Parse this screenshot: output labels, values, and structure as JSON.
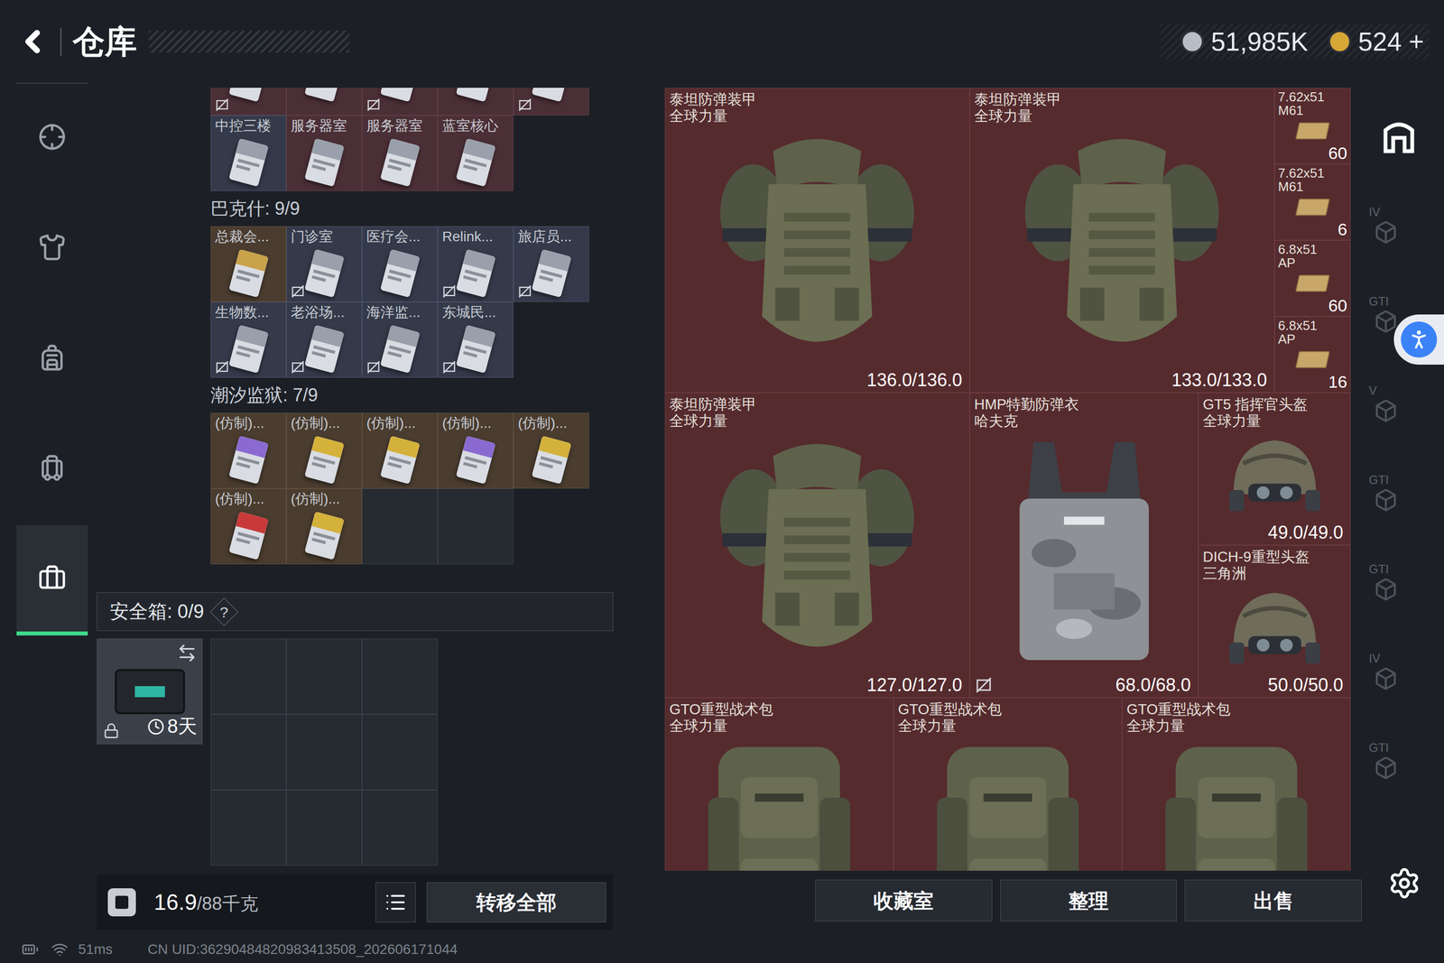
{
  "header": {
    "title": "仓库",
    "currency": [
      {
        "value": "51,985K",
        "color": "#b9bec6"
      },
      {
        "value": "524",
        "color": "#d6a637"
      }
    ],
    "add": "+"
  },
  "nav": [
    {
      "selected": false
    },
    {
      "selected": false
    },
    {
      "selected": false
    },
    {
      "selected": false
    },
    {
      "selected": true
    }
  ],
  "key_sections": [
    {
      "title": "",
      "slots": 9,
      "items": [
        {
          "label": "",
          "rarity": "red",
          "noTrade": true,
          "color": "#9aa0ab"
        },
        {
          "label": "",
          "rarity": "red",
          "noTrade": false,
          "color": "#9aa0ab"
        },
        {
          "label": "",
          "rarity": "red",
          "noTrade": true,
          "color": "#9aa0ab"
        },
        {
          "label": "",
          "rarity": "red",
          "noTrade": false,
          "color": "#9aa0ab"
        },
        {
          "label": "",
          "rarity": "red",
          "noTrade": true,
          "color": "#9aa0ab"
        },
        {
          "label": "中控三楼",
          "rarity": "blue",
          "noTrade": false,
          "color": "#9aa0ab"
        },
        {
          "label": "服务器室",
          "rarity": "red",
          "noTrade": false,
          "color": "#9aa0ab"
        },
        {
          "label": "服务器室",
          "rarity": "red",
          "noTrade": false,
          "color": "#9aa0ab"
        },
        {
          "label": "蓝室核心",
          "rarity": "red",
          "noTrade": false,
          "color": "#9aa0ab"
        }
      ]
    },
    {
      "title": "巴克什: 9/9",
      "slots": 9,
      "items": [
        {
          "label": "总裁会...",
          "rarity": "gold",
          "noTrade": false,
          "color": "#c9a24a"
        },
        {
          "label": "门诊室",
          "rarity": "blue",
          "noTrade": true,
          "color": "#9aa0ab"
        },
        {
          "label": "医疗会...",
          "rarity": "blue",
          "noTrade": false,
          "color": "#9aa0ab"
        },
        {
          "label": "Relink...",
          "rarity": "blue",
          "noTrade": true,
          "color": "#9aa0ab"
        },
        {
          "label": "旅店员...",
          "rarity": "blue",
          "noTrade": true,
          "color": "#9aa0ab"
        },
        {
          "label": "生物数...",
          "rarity": "blue",
          "noTrade": true,
          "color": "#9aa0ab"
        },
        {
          "label": "老浴场...",
          "rarity": "blue",
          "noTrade": true,
          "color": "#9aa0ab"
        },
        {
          "label": "海洋监...",
          "rarity": "blue",
          "noTrade": true,
          "color": "#9aa0ab"
        },
        {
          "label": "东城民...",
          "rarity": "blue",
          "noTrade": true,
          "color": "#9aa0ab"
        }
      ]
    },
    {
      "title": "潮汐监狱: 7/9",
      "slots": 9,
      "items": [
        {
          "label": "(仿制)...",
          "rarity": "gold",
          "noTrade": false,
          "color": "#8a6ad0"
        },
        {
          "label": "(仿制)...",
          "rarity": "gold",
          "noTrade": false,
          "color": "#d4b13a"
        },
        {
          "label": "(仿制)...",
          "rarity": "gold",
          "noTrade": false,
          "color": "#d4b13a"
        },
        {
          "label": "(仿制)...",
          "rarity": "gold",
          "noTrade": false,
          "color": "#8a6ad0"
        },
        {
          "label": "(仿制)...",
          "rarity": "gold",
          "noTrade": false,
          "color": "#d4b13a"
        },
        {
          "label": "(仿制)...",
          "rarity": "gold",
          "noTrade": false,
          "color": "#c83a3a"
        },
        {
          "label": "(仿制)...",
          "rarity": "gold",
          "noTrade": false,
          "color": "#d4b13a"
        }
      ]
    }
  ],
  "safe_box": {
    "label": "安全箱: 0/9",
    "help": "?",
    "timer": "8天",
    "locked": true,
    "slots": 9
  },
  "weight": {
    "current": "16.9",
    "max": "/88千克"
  },
  "transfer_button": "转移全部",
  "items": [
    {
      "kind": "armor",
      "name": "泰坦防弹装甲",
      "sub": "全球力量",
      "value": "136.0/136.0",
      "noTrade": false
    },
    {
      "kind": "armor",
      "name": "泰坦防弹装甲",
      "sub": "全球力量",
      "value": "133.0/133.0",
      "noTrade": false
    },
    {
      "kind": "ammo",
      "name": "7.62x51",
      "sub": "M61",
      "value": "60",
      "noTrade": false
    },
    {
      "kind": "ammo",
      "name": "7.62x51",
      "sub": "M61",
      "value": "6",
      "noTrade": false
    },
    {
      "kind": "ammo",
      "name": "6.8x51",
      "sub": "AP",
      "value": "60",
      "noTrade": false
    },
    {
      "kind": "ammo",
      "name": "6.8x51",
      "sub": "AP",
      "value": "16",
      "noTrade": false
    },
    {
      "kind": "armor",
      "name": "泰坦防弹装甲",
      "sub": "全球力量",
      "value": "127.0/127.0",
      "noTrade": false
    },
    {
      "kind": "vest",
      "name": "HMP特勤防弹衣",
      "sub": "哈夫克",
      "value": "68.0/68.0",
      "noTrade": true
    },
    {
      "kind": "helmet",
      "name": "GT5 指挥官头盔",
      "sub": "全球力量",
      "value": "49.0/49.0",
      "noTrade": false
    },
    {
      "kind": "helmet",
      "name": "DICH-9重型头盔",
      "sub": "三角洲",
      "value": "50.0/50.0",
      "noTrade": false
    },
    {
      "kind": "backpack",
      "name": "GTO重型战术包",
      "sub": "全球力量",
      "value": "",
      "noTrade": false
    },
    {
      "kind": "backpack",
      "name": "GTO重型战术包",
      "sub": "全球力量",
      "value": "",
      "noTrade": false
    },
    {
      "kind": "backpack",
      "name": "GTO重型战术包",
      "sub": "全球力量",
      "value": "",
      "noTrade": false
    }
  ],
  "actions": [
    "收藏室",
    "整理",
    "出售"
  ],
  "side_tabs": [
    {
      "label": "",
      "selected": true
    },
    {
      "label": "IV",
      "selected": false
    },
    {
      "label": "GTI",
      "selected": false
    },
    {
      "label": "V",
      "selected": false
    },
    {
      "label": "GTI",
      "selected": false
    },
    {
      "label": "GTI",
      "selected": false
    },
    {
      "label": "IV",
      "selected": false
    },
    {
      "label": "GTI",
      "selected": false
    }
  ],
  "status": {
    "ping": "51ms",
    "uid": "CN UID:36290484820983413508_202606171044"
  }
}
